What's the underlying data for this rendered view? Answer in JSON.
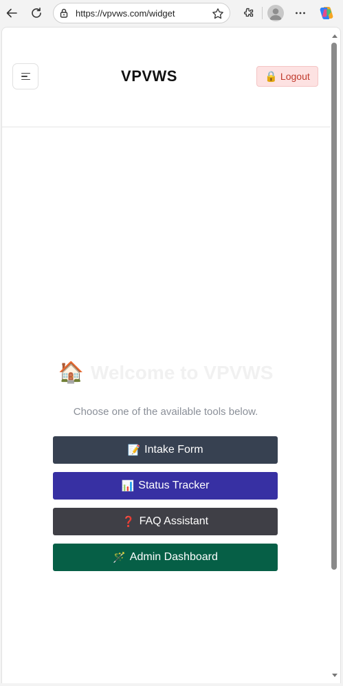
{
  "browser": {
    "url": "https://vpvws.com/widget"
  },
  "header": {
    "title": "VPVWS",
    "logout_label": "Logout",
    "logout_icon": "🔒"
  },
  "welcome": {
    "icon": "🏠",
    "title": "Welcome to VPVWS",
    "subtitle": "Choose one of the available tools below."
  },
  "tools": [
    {
      "icon": "📝",
      "label": "Intake Form",
      "color": "#374151"
    },
    {
      "icon": "📊",
      "label": "Status Tracker",
      "color": "#3730a3"
    },
    {
      "icon": "❓",
      "label": "FAQ Assistant",
      "color": "#3f3f46"
    },
    {
      "icon": "🪄",
      "label": "Admin Dashboard",
      "color": "#065f46"
    }
  ]
}
